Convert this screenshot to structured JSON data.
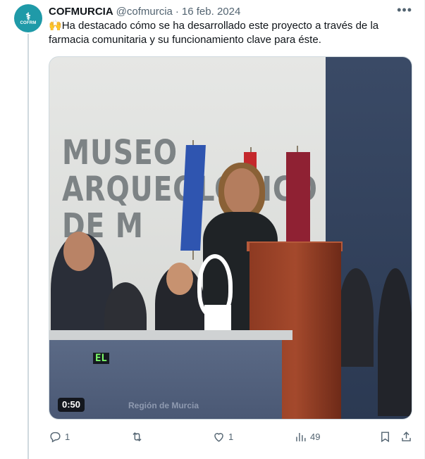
{
  "author": {
    "name": "COFMURCIA",
    "handle": "@cofmurcia",
    "separator": "·",
    "date": "16 feb. 2024",
    "avatar_text": "COFRM",
    "avatar_color": "#1f9aa8"
  },
  "more_icon": "more-horizontal-icon",
  "tweet": {
    "emoji": "🙌",
    "text": "Ha destacado cómo se ha desarrollado este proyecto a través de la farmacia comunitaria y su funcionamiento clave para éste."
  },
  "media": {
    "type": "video",
    "duration": "0:50",
    "subtitle": "EL",
    "sign_text": "MUSEO\nARQUEOLÓGICO\nDE M",
    "banner_text": "Región de Murcia"
  },
  "actions": {
    "reply": {
      "icon": "reply-icon",
      "count": "1"
    },
    "repost": {
      "icon": "repost-icon",
      "count": ""
    },
    "like": {
      "icon": "heart-icon",
      "count": "1"
    },
    "views": {
      "icon": "analytics-icon",
      "count": "49"
    },
    "bookmark": {
      "icon": "bookmark-icon"
    },
    "share": {
      "icon": "share-icon"
    }
  },
  "colors": {
    "text_primary": "#0f1419",
    "text_secondary": "#536471",
    "border": "#cfd9de"
  }
}
